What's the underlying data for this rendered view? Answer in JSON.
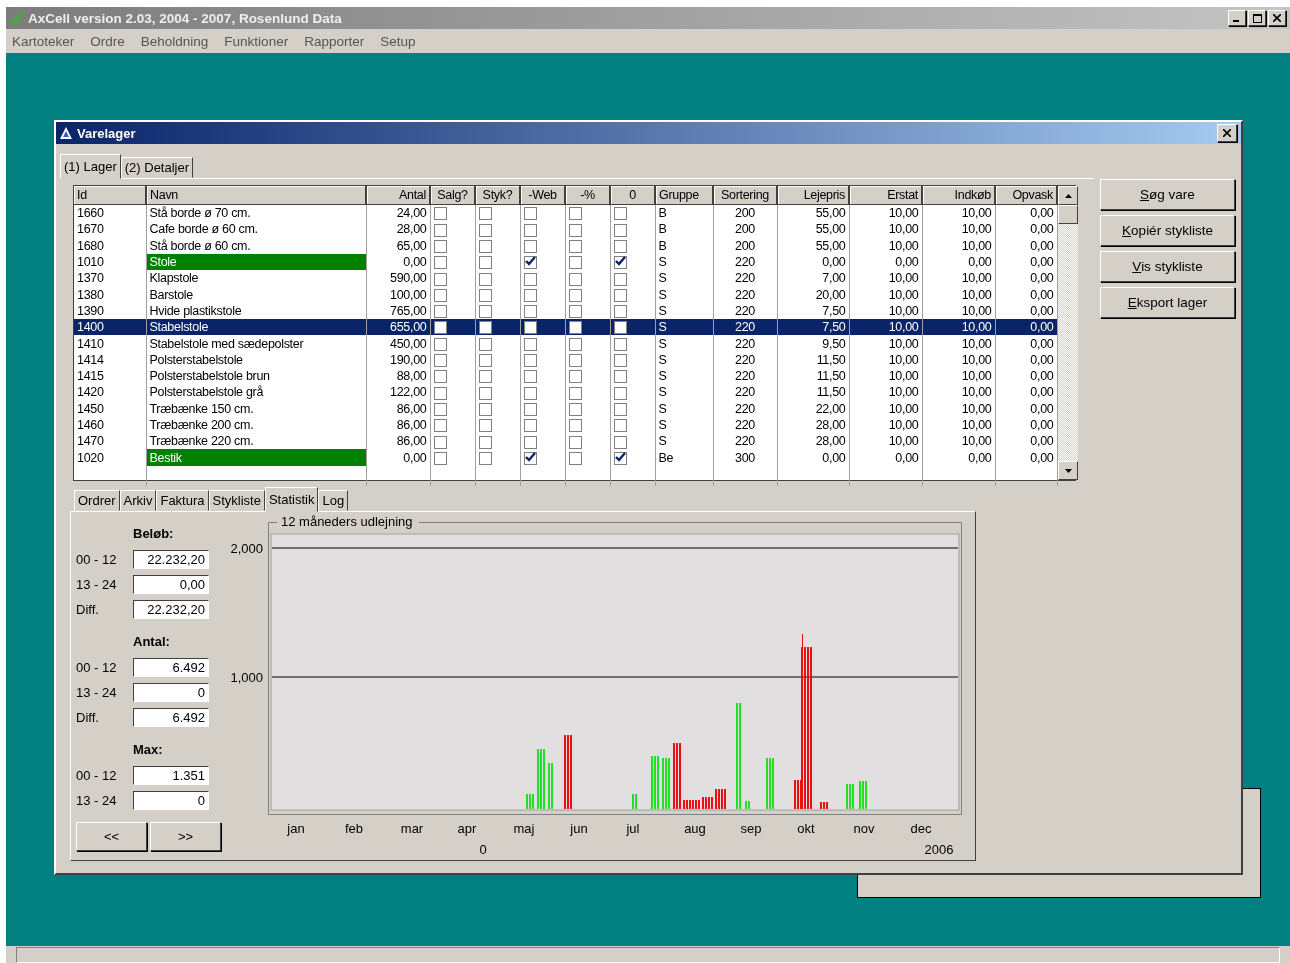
{
  "app_title": "AxCell version 2.03, 2004 - 2007, Rosenlund Data",
  "menu": [
    "Kartoteker",
    "Ordre",
    "Beholdning",
    "Funktioner",
    "Rapporter",
    "Setup"
  ],
  "window": {
    "title": "Varelager",
    "tabs": [
      {
        "label": "(1) Lager",
        "selected": true
      },
      {
        "label": "(2) Detaljer",
        "selected": false
      }
    ],
    "table": {
      "columns": [
        {
          "label": "Id",
          "kind": "text"
        },
        {
          "label": "Navn",
          "kind": "text"
        },
        {
          "label": "Antal",
          "kind": "number"
        },
        {
          "label": "Salg?",
          "kind": "check"
        },
        {
          "label": "Styk?",
          "kind": "check"
        },
        {
          "label": "-Web",
          "kind": "check"
        },
        {
          "label": "-%",
          "kind": "check"
        },
        {
          "label": "0",
          "kind": "check"
        },
        {
          "label": "Gruppe",
          "kind": "text"
        },
        {
          "label": "Sortering",
          "kind": "center"
        },
        {
          "label": "Lejepris",
          "kind": "number"
        },
        {
          "label": "Erstat",
          "kind": "number"
        },
        {
          "label": "Indkøb",
          "kind": "number"
        },
        {
          "label": "Opvask",
          "kind": "number"
        }
      ],
      "rows": [
        {
          "id": "1660",
          "name": "Stå borde ø 70 cm.",
          "stock": "24,00",
          "checks": [
            false,
            false,
            false,
            false,
            false
          ],
          "group": "B",
          "sort": "200",
          "rent": "55,00",
          "replace": "10,00",
          "purchase": "10,00",
          "wash": "0,00",
          "highlighted": false,
          "selected": false
        },
        {
          "id": "1670",
          "name": "Cafe borde ø 60 cm.",
          "stock": "28,00",
          "checks": [
            false,
            false,
            false,
            false,
            false
          ],
          "group": "B",
          "sort": "200",
          "rent": "55,00",
          "replace": "10,00",
          "purchase": "10,00",
          "wash": "0,00",
          "highlighted": false,
          "selected": false
        },
        {
          "id": "1680",
          "name": "Stå borde ø 60 cm.",
          "stock": "65,00",
          "checks": [
            false,
            false,
            false,
            false,
            false
          ],
          "group": "B",
          "sort": "200",
          "rent": "55,00",
          "replace": "10,00",
          "purchase": "10,00",
          "wash": "0,00",
          "highlighted": false,
          "selected": false
        },
        {
          "id": "1010",
          "name": "Stole",
          "stock": "0,00",
          "checks": [
            false,
            false,
            true,
            false,
            true
          ],
          "group": "S",
          "sort": "220",
          "rent": "0,00",
          "replace": "0,00",
          "purchase": "0,00",
          "wash": "0,00",
          "highlighted": true,
          "selected": false
        },
        {
          "id": "1370",
          "name": "Klapstole",
          "stock": "590,00",
          "checks": [
            false,
            false,
            false,
            false,
            false
          ],
          "group": "S",
          "sort": "220",
          "rent": "7,00",
          "replace": "10,00",
          "purchase": "10,00",
          "wash": "0,00",
          "highlighted": false,
          "selected": false
        },
        {
          "id": "1380",
          "name": "Barstole",
          "stock": "100,00",
          "checks": [
            false,
            false,
            false,
            false,
            false
          ],
          "group": "S",
          "sort": "220",
          "rent": "20,00",
          "replace": "10,00",
          "purchase": "10,00",
          "wash": "0,00",
          "highlighted": false,
          "selected": false
        },
        {
          "id": "1390",
          "name": "Hvide plastikstole",
          "stock": "765,00",
          "checks": [
            false,
            false,
            false,
            false,
            false
          ],
          "group": "S",
          "sort": "220",
          "rent": "7,50",
          "replace": "10,00",
          "purchase": "10,00",
          "wash": "0,00",
          "highlighted": false,
          "selected": false
        },
        {
          "id": "1400",
          "name": "Stabelstole",
          "stock": "655,00",
          "checks": [
            false,
            false,
            false,
            false,
            false
          ],
          "group": "S",
          "sort": "220",
          "rent": "7,50",
          "replace": "10,00",
          "purchase": "10,00",
          "wash": "0,00",
          "highlighted": false,
          "selected": true
        },
        {
          "id": "1410",
          "name": "Stabelstole med sædepolster",
          "stock": "450,00",
          "checks": [
            false,
            false,
            false,
            false,
            false
          ],
          "group": "S",
          "sort": "220",
          "rent": "9,50",
          "replace": "10,00",
          "purchase": "10,00",
          "wash": "0,00",
          "highlighted": false,
          "selected": false
        },
        {
          "id": "1414",
          "name": "Polsterstabelstole",
          "stock": "190,00",
          "checks": [
            false,
            false,
            false,
            false,
            false
          ],
          "group": "S",
          "sort": "220",
          "rent": "11,50",
          "replace": "10,00",
          "purchase": "10,00",
          "wash": "0,00",
          "highlighted": false,
          "selected": false
        },
        {
          "id": "1415",
          "name": "Polsterstabelstole brun",
          "stock": "88,00",
          "checks": [
            false,
            false,
            false,
            false,
            false
          ],
          "group": "S",
          "sort": "220",
          "rent": "11,50",
          "replace": "10,00",
          "purchase": "10,00",
          "wash": "0,00",
          "highlighted": false,
          "selected": false
        },
        {
          "id": "1420",
          "name": "Polsterstabelstole grå",
          "stock": "122,00",
          "checks": [
            false,
            false,
            false,
            false,
            false
          ],
          "group": "S",
          "sort": "220",
          "rent": "11,50",
          "replace": "10,00",
          "purchase": "10,00",
          "wash": "0,00",
          "highlighted": false,
          "selected": false
        },
        {
          "id": "1450",
          "name": "Træbænke 150 cm.",
          "stock": "86,00",
          "checks": [
            false,
            false,
            false,
            false,
            false
          ],
          "group": "S",
          "sort": "220",
          "rent": "22,00",
          "replace": "10,00",
          "purchase": "10,00",
          "wash": "0,00",
          "highlighted": false,
          "selected": false
        },
        {
          "id": "1460",
          "name": "Træbænke 200 cm.",
          "stock": "86,00",
          "checks": [
            false,
            false,
            false,
            false,
            false
          ],
          "group": "S",
          "sort": "220",
          "rent": "28,00",
          "replace": "10,00",
          "purchase": "10,00",
          "wash": "0,00",
          "highlighted": false,
          "selected": false
        },
        {
          "id": "1470",
          "name": "Træbænke 220 cm.",
          "stock": "86,00",
          "checks": [
            false,
            false,
            false,
            false,
            false
          ],
          "group": "S",
          "sort": "220",
          "rent": "28,00",
          "replace": "10,00",
          "purchase": "10,00",
          "wash": "0,00",
          "highlighted": false,
          "selected": false
        },
        {
          "id": "1020",
          "name": "Bestik",
          "stock": "0,00",
          "checks": [
            false,
            false,
            true,
            false,
            true
          ],
          "group": "Be",
          "sort": "300",
          "rent": "0,00",
          "replace": "0,00",
          "purchase": "0,00",
          "wash": "0,00",
          "highlighted": true,
          "selected": false
        }
      ]
    },
    "buttons": [
      "Søg vare",
      "Kopiér stykliste",
      "Vis stykliste",
      "Eksport lager"
    ],
    "detail_tabs": [
      {
        "label": "Ordrer",
        "selected": false
      },
      {
        "label": "Arkiv",
        "selected": false
      },
      {
        "label": "Faktura",
        "selected": false
      },
      {
        "label": "Stykliste",
        "selected": false
      },
      {
        "label": "Statistik",
        "selected": true
      },
      {
        "label": "Log",
        "selected": false
      }
    ],
    "stats": [
      {
        "title": "Beløb:",
        "fields": [
          {
            "label": "00 - 12",
            "value": "22.232,20"
          },
          {
            "label": "13 - 24",
            "value": "0,00"
          },
          {
            "label": "Diff.",
            "value": "22.232,20"
          }
        ]
      },
      {
        "title": "Antal:",
        "fields": [
          {
            "label": "00 - 12",
            "value": "6.492"
          },
          {
            "label": "13 - 24",
            "value": "0"
          },
          {
            "label": "Diff.",
            "value": "6.492"
          }
        ]
      },
      {
        "title": "Max:",
        "fields": [
          {
            "label": "00 - 12",
            "value": "1.351"
          },
          {
            "label": "13 - 24",
            "value": "0"
          }
        ]
      }
    ],
    "nav_buttons": [
      "<<",
      ">>"
    ],
    "chart": {
      "title": "12 måneders udlejning",
      "y_labels": [
        "2,000",
        "1,000"
      ],
      "months": [
        "jan",
        "feb",
        "mar",
        "apr",
        "maj",
        "jun",
        "jul",
        "aug",
        "sep",
        "okt",
        "nov",
        "dec"
      ],
      "baseline_label": "0",
      "year_label": "2006"
    }
  }
}
